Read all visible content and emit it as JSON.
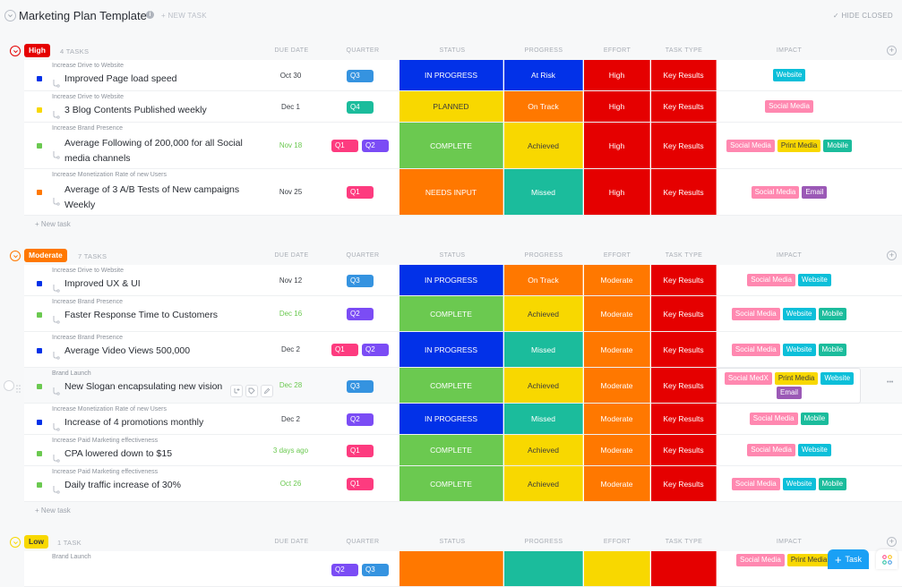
{
  "header": {
    "title": "Marketing Plan Template",
    "new_task": "+ NEW TASK",
    "hide_closed": "HIDE CLOSED"
  },
  "columns": {
    "due_date": "DUE DATE",
    "quarter": "QUARTER",
    "status": "STATUS",
    "progress": "PROGRESS",
    "effort": "EFFORT",
    "task_type": "TASK TYPE",
    "impact": "IMPACT"
  },
  "colors": {
    "q1": "#fd3b7f",
    "q2": "#7b4cf5",
    "q3": "#3593e0",
    "q4": "#1bbc9c",
    "in_progress": "#0231e8",
    "planned": "#f8d800",
    "complete": "#6bc950",
    "needs_input": "#ff7800",
    "at_risk": "#0231e8",
    "on_track": "#ff7800",
    "achieved": "#f8d800",
    "missed": "#1bbc9c",
    "effort_high": "#e50000",
    "effort_moderate": "#ff7800",
    "effort_low": "#f8d800",
    "key_results": "#e50000",
    "social_media": "#ff88b0",
    "website": "#0cbfd9",
    "print_media": "#f8d800",
    "mobile": "#1bbc9c",
    "email": "#9b59b6",
    "priority_high": "#e50000",
    "priority_moderate": "#ff7800",
    "priority_low": "#f8d800"
  },
  "new_task_label": "+ New task",
  "fab_label": "Task",
  "groups": [
    {
      "name": "High",
      "count": "4 TASKS",
      "tasks": [
        {
          "parent": "Increase Drive to Website",
          "name": "Improved Page load speed",
          "due": "Oct 30",
          "due_green": false,
          "sq": "in_progress",
          "quarters": [
            "Q3"
          ],
          "status": "IN PROGRESS",
          "progress": "At Risk",
          "effort": "High",
          "task_type": "Key Results",
          "impact": [
            "Website"
          ]
        },
        {
          "parent": "Increase Drive to Website",
          "name": "3 Blog Contents Published weekly",
          "due": "Dec 1",
          "due_green": false,
          "sq": "planned",
          "quarters": [
            "Q4"
          ],
          "status": "PLANNED",
          "progress": "On Track",
          "effort": "High",
          "task_type": "Key Results",
          "impact": [
            "Social Media"
          ]
        },
        {
          "parent": "Increase Brand Presence",
          "name": "Average Following of 200,000 for all Social media channels",
          "due": "Nov 18",
          "due_green": true,
          "sq": "complete",
          "quarters": [
            "Q1",
            "Q2"
          ],
          "status": "COMPLETE",
          "progress": "Achieved",
          "effort": "High",
          "task_type": "Key Results",
          "impact": [
            "Social Media",
            "Print Media",
            "Mobile"
          ]
        },
        {
          "parent": "Increase Monetization Rate of new Users",
          "name": "Average of 3 A/B Tests of New campaigns Weekly",
          "due": "Nov 25",
          "due_green": false,
          "sq": "needs_input",
          "quarters": [
            "Q1"
          ],
          "status": "NEEDS INPUT",
          "progress": "Missed",
          "effort": "High",
          "task_type": "Key Results",
          "impact": [
            "Social Media",
            "Email"
          ]
        }
      ]
    },
    {
      "name": "Moderate",
      "count": "7 TASKS",
      "tasks": [
        {
          "parent": "Increase Drive to Website",
          "name": "Improved UX & UI",
          "due": "Nov 12",
          "due_green": false,
          "sq": "in_progress",
          "quarters": [
            "Q3"
          ],
          "status": "IN PROGRESS",
          "progress": "On Track",
          "effort": "Moderate",
          "task_type": "Key Results",
          "impact": [
            "Social Media",
            "Website"
          ]
        },
        {
          "parent": "Increase Brand Presence",
          "name": "Faster Response Time to Customers",
          "due": "Dec 16",
          "due_green": true,
          "sq": "complete",
          "quarters": [
            "Q2"
          ],
          "status": "COMPLETE",
          "progress": "Achieved",
          "effort": "Moderate",
          "task_type": "Key Results",
          "impact": [
            "Social Media",
            "Website",
            "Mobile"
          ]
        },
        {
          "parent": "Increase Brand Presence",
          "name": "Average Video Views 500,000",
          "due": "Dec 2",
          "due_green": false,
          "sq": "in_progress",
          "quarters": [
            "Q1",
            "Q2"
          ],
          "status": "IN PROGRESS",
          "progress": "Missed",
          "effort": "Moderate",
          "task_type": "Key Results",
          "impact": [
            "Social Media",
            "Website",
            "Mobile"
          ]
        },
        {
          "parent": "Brand Launch",
          "name": "New Slogan encapsulating new vision",
          "due": "Dec 28",
          "due_green": true,
          "sq": "complete",
          "quarters": [
            "Q3"
          ],
          "status": "COMPLETE",
          "progress": "Achieved",
          "effort": "Moderate",
          "task_type": "Key Results",
          "impact": [
            "Social MedX",
            "Print Media",
            "Website",
            "Email"
          ]
        },
        {
          "parent": "Increase Monetization Rate of new Users",
          "name": "Increase of 4 promotions monthly",
          "due": "Dec 2",
          "due_green": false,
          "sq": "in_progress",
          "quarters": [
            "Q2"
          ],
          "status": "IN PROGRESS",
          "progress": "Missed",
          "effort": "Moderate",
          "task_type": "Key Results",
          "impact": [
            "Social Media",
            "Mobile"
          ]
        },
        {
          "parent": "Increase Paid Marketing effectiveness",
          "name": "CPA lowered down to $15",
          "due": "3 days ago",
          "due_green": true,
          "sq": "complete",
          "quarters": [
            "Q1"
          ],
          "status": "COMPLETE",
          "progress": "Achieved",
          "effort": "Moderate",
          "task_type": "Key Results",
          "impact": [
            "Social Media",
            "Website"
          ]
        },
        {
          "parent": "Increase Paid Marketing effectiveness",
          "name": "Daily traffic increase of 30%",
          "due": "Oct 26",
          "due_green": true,
          "sq": "complete",
          "quarters": [
            "Q1"
          ],
          "status": "COMPLETE",
          "progress": "Achieved",
          "effort": "Moderate",
          "task_type": "Key Results",
          "impact": [
            "Social Media",
            "Website",
            "Mobile"
          ]
        }
      ]
    },
    {
      "name": "Low",
      "count": "1 TASK",
      "tasks": [
        {
          "parent": "Brand Launch",
          "name": "",
          "due": "",
          "due_green": false,
          "sq": "",
          "quarters": [
            "Q2",
            "Q3"
          ],
          "status": "",
          "progress": "",
          "effort": "",
          "task_type": "",
          "impact": [
            "Social Media",
            "Print Media"
          ]
        }
      ]
    }
  ]
}
